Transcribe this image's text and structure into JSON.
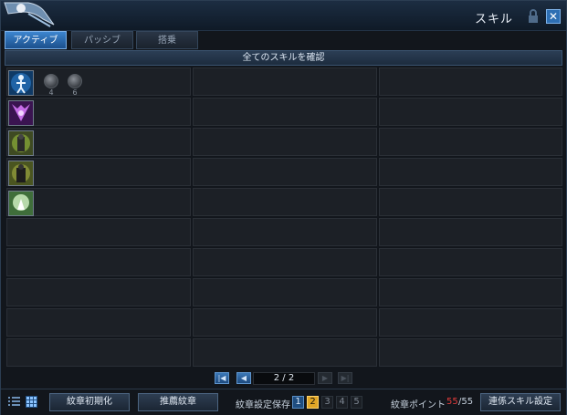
{
  "window": {
    "title": "スキル"
  },
  "tabs": [
    {
      "label": "アクティブ",
      "active": true
    },
    {
      "label": "パッシブ",
      "active": false
    },
    {
      "label": "搭乗",
      "active": false
    }
  ],
  "header": {
    "text": "全てのスキルを確認"
  },
  "skills": [
    {
      "icon": "figure-energy-icon",
      "runes": [
        {
          "number": "4"
        },
        {
          "number": "6"
        }
      ]
    },
    {
      "icon": "purple-shadow-icon"
    },
    {
      "icon": "green-knight-icon"
    },
    {
      "icon": "dark-armor-icon"
    },
    {
      "icon": "white-light-icon"
    }
  ],
  "grid": {
    "rows": 10,
    "cols": 3
  },
  "pager": {
    "page": "2 / 2"
  },
  "footer": {
    "reset_label": "紋章初期化",
    "recommend_label": "推薦紋章",
    "save_label": "紋章設定保存",
    "slots": [
      "1",
      "2",
      "3",
      "4",
      "5"
    ],
    "selected_slot": "2",
    "points_label": "紋章ポイント",
    "points_current": "55",
    "points_max": "/55",
    "combo_label": "連係スキル設定"
  },
  "colors": {
    "accent": "#2e6fb3",
    "selected": "#e0a526",
    "points": "#e23b3b"
  }
}
